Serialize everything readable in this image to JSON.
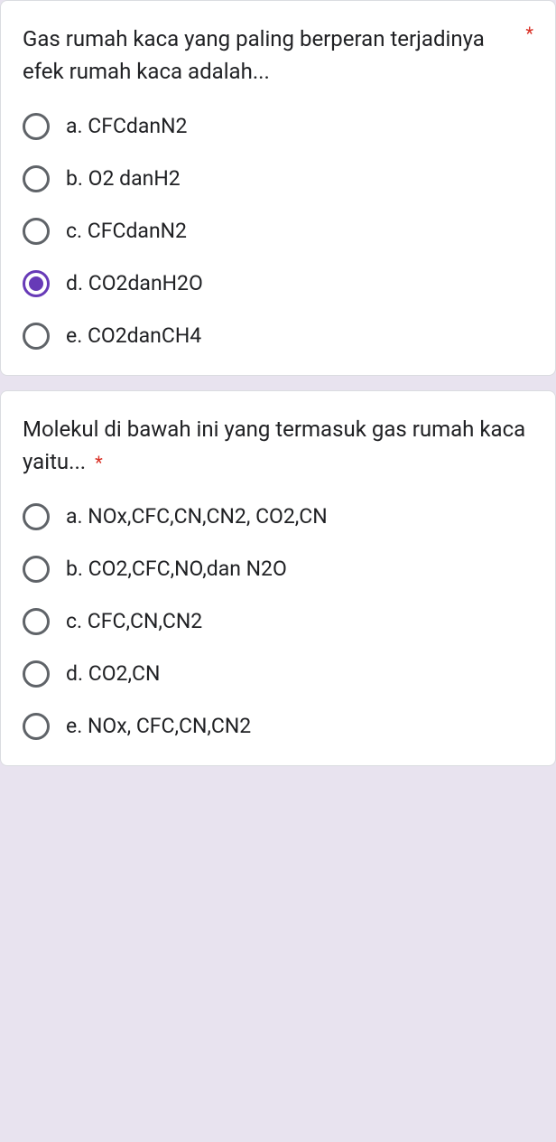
{
  "questions": [
    {
      "text": "Gas rumah kaca yang paling berperan terjadinya efek rumah kaca adalah...",
      "required": "*",
      "options": [
        {
          "label": "a. CFCdanN2",
          "selected": false
        },
        {
          "label": "b. O2 danH2",
          "selected": false
        },
        {
          "label": "c. CFCdanN2",
          "selected": false
        },
        {
          "label": "d. CO2danH2O",
          "selected": true
        },
        {
          "label": "e. CO2danCH4",
          "selected": false
        }
      ]
    },
    {
      "text": "Molekul di bawah ini yang termasuk gas rumah kaca yaitu...",
      "required": "*",
      "options": [
        {
          "label": "a. NOx,CFC,CN,CN2, CO2,CN",
          "selected": false
        },
        {
          "label": "b. CO2,CFC,NO,dan N2O",
          "selected": false
        },
        {
          "label": "c. CFC,CN,CN2",
          "selected": false
        },
        {
          "label": "d. CO2,CN",
          "selected": false
        },
        {
          "label": "e. NOx, CFC,CN,CN2",
          "selected": false
        }
      ]
    }
  ]
}
